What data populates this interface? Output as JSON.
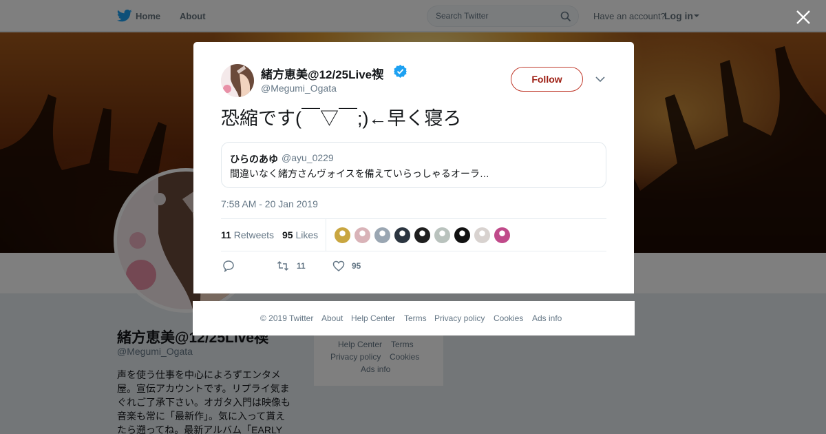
{
  "nav": {
    "home_label": "Home",
    "about_label": "About",
    "search_placeholder": "Search Twitter",
    "have_account_text": "Have an account?",
    "login_label": "Log in"
  },
  "profile": {
    "name": "緒方恵美@12/25Live禊",
    "handle": "@Megumi_Ogata",
    "bio_lines": [
      "声を使う仕事を中心によろずエンタメ",
      "屋。宣伝アカウントです。リプライ気ま",
      "ぐれご了承下さい。オガタ入門は映像も",
      "音楽も常に「最新作」。気に入って貰え",
      "たら遡ってね。最新アルバム「EARLY"
    ],
    "footer_links": [
      "Help Center",
      "Terms",
      "Privacy policy",
      "Cookies",
      "Ads info"
    ]
  },
  "tweet": {
    "author_name": "緒方恵美@12/25Live禊",
    "author_handle": "@Megumi_Ogata",
    "follow_label": "Follow",
    "text": "恐縮です(￣▽￣;)←早く寝ろ",
    "quote": {
      "name": "ひらのあゆ",
      "handle": "@ayu_0229",
      "text": "間違いなく緒方さんヴォイスを備えていらっしゃるオーラ…"
    },
    "timestamp": "7:58 AM - 20 Jan 2019",
    "retweets_count": "11",
    "retweets_label": "Retweets",
    "likes_count": "95",
    "likes_label": "Likes",
    "likers": [
      {
        "name": "liker-1",
        "color": "#c9a640"
      },
      {
        "name": "liker-2",
        "color": "#d9b3b8"
      },
      {
        "name": "liker-3",
        "color": "#9aa6b2"
      },
      {
        "name": "liker-4",
        "color": "#2b3540"
      },
      {
        "name": "liker-5",
        "color": "#1e1e1e"
      },
      {
        "name": "liker-6",
        "color": "#b9c2bd"
      },
      {
        "name": "liker-7",
        "color": "#111111"
      },
      {
        "name": "liker-8",
        "color": "#d8d2cf"
      },
      {
        "name": "liker-9",
        "color": "#c04a8a"
      }
    ],
    "action_retweet_count": "11",
    "action_like_count": "95"
  },
  "footer": {
    "links": [
      "© 2019 Twitter",
      "About",
      "Help Center",
      "Terms",
      "Privacy policy",
      "Cookies",
      "Ads info"
    ]
  },
  "colors": {
    "twitter_blue": "#1da1f2",
    "follow_red": "#9c1c10",
    "muted_text": "#657786"
  }
}
